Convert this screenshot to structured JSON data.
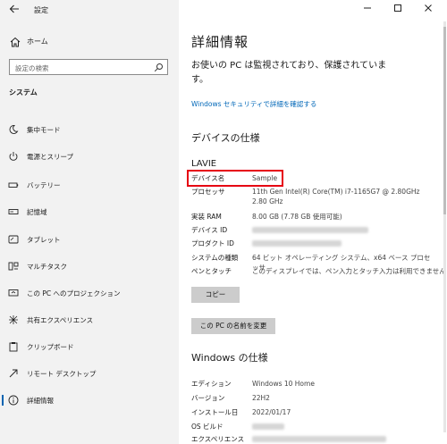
{
  "window": {
    "title": "設定"
  },
  "sidebar": {
    "home_label": "ホーム",
    "search_placeholder": "設定の検索",
    "section": "システム",
    "items": [
      {
        "label": "集中モード",
        "icon": "moon-icon"
      },
      {
        "label": "電源とスリープ",
        "icon": "power-icon"
      },
      {
        "label": "バッテリー",
        "icon": "battery-icon"
      },
      {
        "label": "記憶域",
        "icon": "storage-icon"
      },
      {
        "label": "タブレット",
        "icon": "tablet-icon"
      },
      {
        "label": "マルチタスク",
        "icon": "multitask-icon"
      },
      {
        "label": "この PC へのプロジェクション",
        "icon": "projection-icon"
      },
      {
        "label": "共有エクスペリエンス",
        "icon": "share-icon"
      },
      {
        "label": "クリップボード",
        "icon": "clipboard-icon"
      },
      {
        "label": "リモート デスクトップ",
        "icon": "remote-desktop-icon"
      },
      {
        "label": "詳細情報",
        "icon": "info-icon",
        "active": true
      }
    ]
  },
  "main": {
    "title": "詳細情報",
    "notice": "お使いの PC は監視されており、保護されています。",
    "security_link": "Windows セキュリティで詳細を確認する",
    "device_spec": {
      "heading": "デバイスの仕様",
      "device_name": "LAVIE",
      "rows": [
        {
          "key": "デバイス名",
          "value": "Sample"
        },
        {
          "key": "プロセッサ",
          "value": "11th Gen Intel(R) Core(TM) i7-1165G7 @ 2.80GHz 2.80 GHz"
        },
        {
          "key": "実装 RAM",
          "value": "8.00 GB (7.78 GB 使用可能)"
        },
        {
          "key": "デバイス ID",
          "value": ""
        },
        {
          "key": "プロダクト ID",
          "value": ""
        },
        {
          "key": "システムの種類",
          "value": "64 ビット オペレーティング システム、x64 ベース プロセッサ"
        },
        {
          "key": "ペンとタッチ",
          "value": "このディスプレイでは、ペン入力とタッチ入力は利用できません"
        }
      ],
      "copy_button": "コピー",
      "rename_button": "この PC の名前を変更"
    },
    "windows_spec": {
      "heading": "Windows の仕様",
      "rows": [
        {
          "key": "エディション",
          "value": "Windows 10 Home"
        },
        {
          "key": "バージョン",
          "value": "22H2"
        },
        {
          "key": "インストール日",
          "value": "2022/01/17"
        },
        {
          "key": "OS ビルド",
          "value": ""
        },
        {
          "key": "エクスペリエンス",
          "value": ""
        }
      ]
    }
  },
  "colors": {
    "accent": "#0063b1",
    "link": "#0067b8",
    "highlight": "#e60012",
    "sidebar_bg": "#f2f2f2"
  }
}
